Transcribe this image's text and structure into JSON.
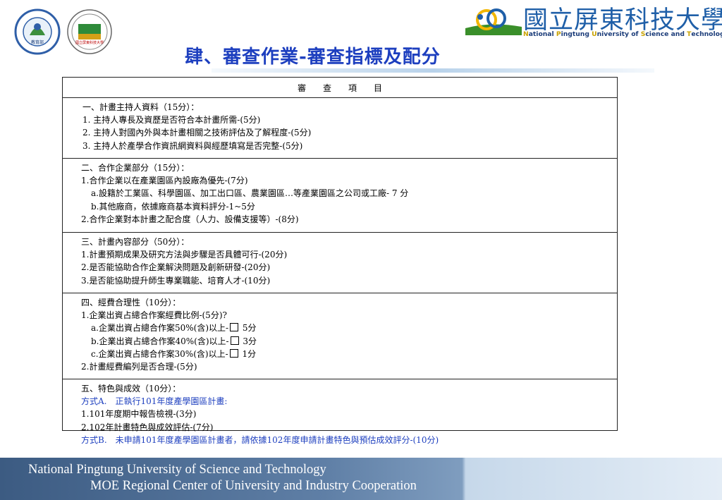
{
  "header": {
    "university_cn": "國立屏東科技大學",
    "university_en": [
      {
        "cap": "N",
        "rest": "ational "
      },
      {
        "cap": "P",
        "rest": "ingtung "
      },
      {
        "cap": "U",
        "rest": "niversity of "
      },
      {
        "cap": "S",
        "rest": "cience and "
      },
      {
        "cap": "T",
        "rest": "echnology"
      }
    ],
    "moe_logo_text": "教育部",
    "npust_logo_text": "國立屏東科技大學"
  },
  "title": "肆、審查作業-審查指標及配分",
  "table": {
    "header": "審　　查　　項　　目",
    "sections": [
      {
        "lines": [
          {
            "text": "一、計畫主持人資料（15分）："
          },
          {
            "text": "1. 主持人專長及資歷是否符合本計畫所需-(5分)"
          },
          {
            "text": "2. 主持人對國內外與本計畫相關之技術評估及了解程度-(5分)"
          },
          {
            "text": "3. 主持人於產學合作資訊網資料與經歷填寫是否完整-(5分)"
          }
        ]
      },
      {
        "lines": [
          {
            "text": "二、合作企業部分（15分）："
          },
          {
            "text": "1.合作企業以在產業園區內設廠為優先-(7分)"
          },
          {
            "text": "a.設籍於工業區、科學園區、加工出口區、農業園區…等產業園區之公司或工廠- 7 分"
          },
          {
            "text": "b.其他廠商，依據廠商基本資料評分-1~5分"
          },
          {
            "text": "2.合作企業對本計畫之配合度（人力、設備支援等）-(8分)"
          }
        ]
      },
      {
        "lines": [
          {
            "text": "三、計畫內容部分（50分）："
          },
          {
            "text": "1.計畫預期成果及研究方法與步驟是否具體可行-(20分)"
          },
          {
            "text": "2.是否能協助合作企業解決問題及創新研發-(20分)"
          },
          {
            "text": "3.是否能協助提升師生專業職能、培育人才-(10分)"
          }
        ]
      },
      {
        "lines": [
          {
            "text": "四、經費合理性（10分）："
          },
          {
            "text": "1.企業出資占總合作案經費比例-(5分)?"
          },
          {
            "pre": "a.企業出資占總合作案50%(含)以上-",
            "post": " 5分"
          },
          {
            "pre": "b.企業出資占總合作案40%(含)以上-",
            "post": " 3分"
          },
          {
            "pre": "c.企業出資占總合作案30%(含)以上-",
            "post": " 1分"
          },
          {
            "text": "2.計畫經費編列是否合理-(5分)"
          }
        ]
      },
      {
        "lines": [
          {
            "text": "五、特色與成效（10分）："
          },
          {
            "text": "方式A.　正執行101年度產學園區計畫:"
          },
          {
            "text": "1.101年度期中報告檢視-(3分)"
          },
          {
            "text": "2.102年計畫特色與成效評估-(7分)"
          },
          {
            "text": "方式B.　未申請101年度產學園區計畫者，請依據102年度申請計畫特色與預估成效評分-(10分)"
          }
        ]
      }
    ]
  },
  "footer": {
    "line1": "National Pingtung University of Science and Technology",
    "line2": "MOE Regional Center of University and Industry Cooperation"
  },
  "colors": {
    "title": "#1d3fbf",
    "highlight_text": "#1d3fbf",
    "brand_blue": "#1f5fa8",
    "footer_bg": "#4a6a92"
  }
}
